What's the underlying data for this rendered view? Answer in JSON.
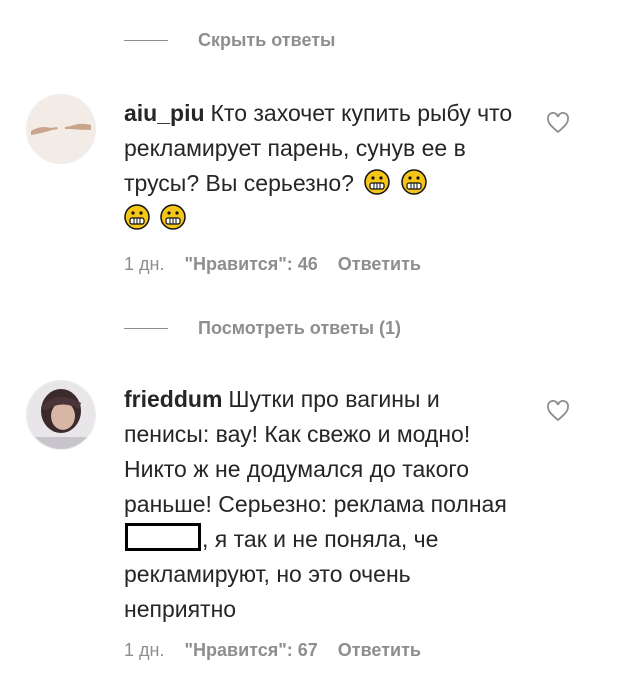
{
  "threads": {
    "hide_replies_label": "Скрыть ответы",
    "view_replies_label": "Посмотреть ответы (1)"
  },
  "comments": [
    {
      "username": "aiu_piu",
      "text": "Кто захочет купить рыбу что рекламирует парень, сунув ее в трусы? Вы серьезно?",
      "emoji": [
        "grimacing-face",
        "grimacing-face",
        "grimacing-face",
        "grimacing-face"
      ],
      "time": "1 дн.",
      "likes": "\"Нравится\": 46",
      "reply_label": "Ответить"
    },
    {
      "username": "frieddum",
      "text_before": "Шутки про вагины и пенисы: вау! Как свежо и модно! Никто ж не додумался до такого раньше! Серьезно: реклама полная",
      "text_after": ", я так и не поняла, че рекламируют, но это очень неприятно",
      "time": "1 дн.",
      "likes": "\"Нравится\": 67",
      "reply_label": "Ответить"
    }
  ],
  "colors": {
    "text": "#262626",
    "muted": "#8e8e8e",
    "emoji": "#f5c518"
  }
}
